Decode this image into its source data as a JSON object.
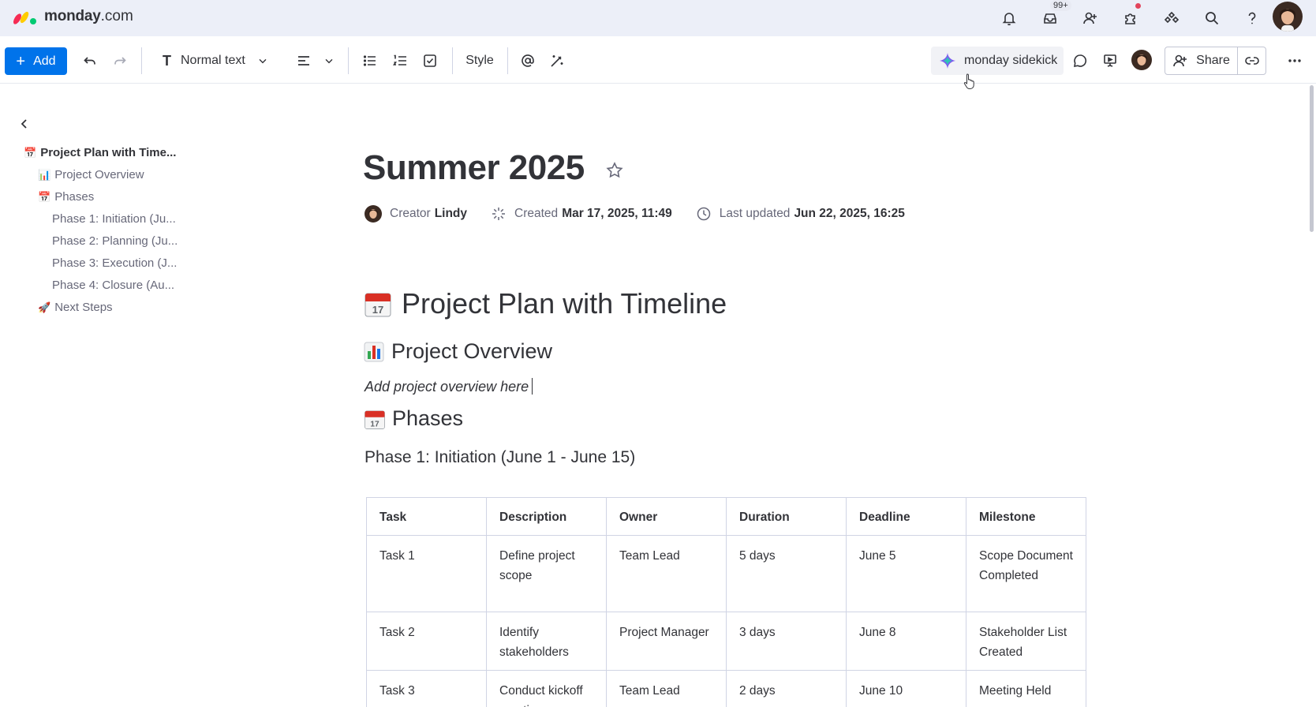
{
  "app": {
    "brand_name": "monday",
    "brand_suffix": ".com",
    "accent": "#0073ea"
  },
  "topbar": {
    "icons": [
      "bell-icon",
      "inbox-icon",
      "invite-member-icon",
      "apps-icon",
      "integrations-icon",
      "search-icon",
      "help-icon",
      "monday-logo-icon",
      "avatar"
    ],
    "inbox_badge": "99+"
  },
  "toolbar": {
    "add_label": "Add",
    "text_style": "Normal text",
    "style_label": "Style",
    "sidekick_label": "monday sidekick",
    "share_label": "Share"
  },
  "outline": {
    "items": [
      {
        "label": "Project Plan with Time...",
        "emoji": "📅",
        "level": 0
      },
      {
        "label": "Project Overview",
        "emoji": "📊",
        "level": 1
      },
      {
        "label": "Phases",
        "emoji": "📅",
        "level": 1
      },
      {
        "label": "Phase 1: Initiation (Ju...",
        "emoji": "",
        "level": 2
      },
      {
        "label": "Phase 2: Planning (Ju...",
        "emoji": "",
        "level": 2
      },
      {
        "label": "Phase 3: Execution (J...",
        "emoji": "",
        "level": 2
      },
      {
        "label": "Phase 4: Closure (Au...",
        "emoji": "",
        "level": 2
      },
      {
        "label": "Next Steps",
        "emoji": "🚀",
        "level": 1
      }
    ]
  },
  "doc": {
    "title": "Summer 2025",
    "meta": {
      "creator_label": "Creator",
      "creator_name": "Lindy",
      "created_label": "Created",
      "created_value": "Mar 17, 2025, 11:49",
      "updated_label": "Last updated",
      "updated_value": "Jun 22, 2025, 16:25"
    },
    "heading_main": "Project Plan with Timeline",
    "heading_overview": "Project Overview",
    "overview_text": "Add project overview here",
    "heading_phases": "Phases",
    "phase1_heading": "Phase 1: Initiation (June 1 - June 15)",
    "table": {
      "headers": [
        "Task",
        "Description",
        "Owner",
        "Duration",
        "Deadline",
        "Milestone"
      ],
      "rows": [
        [
          "Task 1",
          "Define project scope",
          "Team Lead",
          "5 days",
          "June 5",
          "Scope Document Completed"
        ],
        [
          "Task 2",
          "Identify stakeholders",
          "Project Manager",
          "3 days",
          "June 8",
          "Stakeholder List Created"
        ],
        [
          "Task 3",
          "Conduct kickoff meeting",
          "Team Lead",
          "2 days",
          "June 10",
          "Meeting Held"
        ]
      ]
    }
  }
}
